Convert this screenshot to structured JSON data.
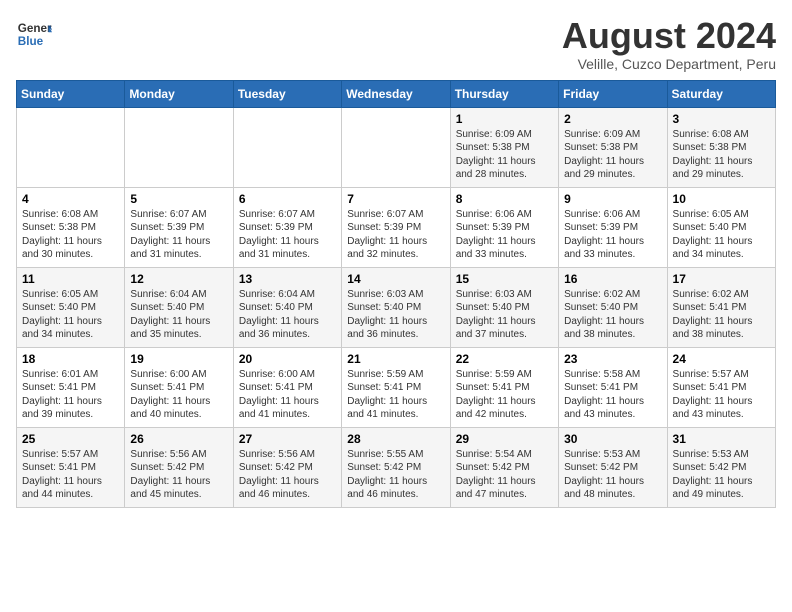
{
  "header": {
    "logo_general": "General",
    "logo_blue": "Blue",
    "month_year": "August 2024",
    "location": "Velille, Cuzco Department, Peru"
  },
  "weekdays": [
    "Sunday",
    "Monday",
    "Tuesday",
    "Wednesday",
    "Thursday",
    "Friday",
    "Saturday"
  ],
  "weeks": [
    [
      {
        "day": "",
        "info": ""
      },
      {
        "day": "",
        "info": ""
      },
      {
        "day": "",
        "info": ""
      },
      {
        "day": "",
        "info": ""
      },
      {
        "day": "1",
        "info": "Sunrise: 6:09 AM\nSunset: 5:38 PM\nDaylight: 11 hours\nand 28 minutes."
      },
      {
        "day": "2",
        "info": "Sunrise: 6:09 AM\nSunset: 5:38 PM\nDaylight: 11 hours\nand 29 minutes."
      },
      {
        "day": "3",
        "info": "Sunrise: 6:08 AM\nSunset: 5:38 PM\nDaylight: 11 hours\nand 29 minutes."
      }
    ],
    [
      {
        "day": "4",
        "info": "Sunrise: 6:08 AM\nSunset: 5:38 PM\nDaylight: 11 hours\nand 30 minutes."
      },
      {
        "day": "5",
        "info": "Sunrise: 6:07 AM\nSunset: 5:39 PM\nDaylight: 11 hours\nand 31 minutes."
      },
      {
        "day": "6",
        "info": "Sunrise: 6:07 AM\nSunset: 5:39 PM\nDaylight: 11 hours\nand 31 minutes."
      },
      {
        "day": "7",
        "info": "Sunrise: 6:07 AM\nSunset: 5:39 PM\nDaylight: 11 hours\nand 32 minutes."
      },
      {
        "day": "8",
        "info": "Sunrise: 6:06 AM\nSunset: 5:39 PM\nDaylight: 11 hours\nand 33 minutes."
      },
      {
        "day": "9",
        "info": "Sunrise: 6:06 AM\nSunset: 5:39 PM\nDaylight: 11 hours\nand 33 minutes."
      },
      {
        "day": "10",
        "info": "Sunrise: 6:05 AM\nSunset: 5:40 PM\nDaylight: 11 hours\nand 34 minutes."
      }
    ],
    [
      {
        "day": "11",
        "info": "Sunrise: 6:05 AM\nSunset: 5:40 PM\nDaylight: 11 hours\nand 34 minutes."
      },
      {
        "day": "12",
        "info": "Sunrise: 6:04 AM\nSunset: 5:40 PM\nDaylight: 11 hours\nand 35 minutes."
      },
      {
        "day": "13",
        "info": "Sunrise: 6:04 AM\nSunset: 5:40 PM\nDaylight: 11 hours\nand 36 minutes."
      },
      {
        "day": "14",
        "info": "Sunrise: 6:03 AM\nSunset: 5:40 PM\nDaylight: 11 hours\nand 36 minutes."
      },
      {
        "day": "15",
        "info": "Sunrise: 6:03 AM\nSunset: 5:40 PM\nDaylight: 11 hours\nand 37 minutes."
      },
      {
        "day": "16",
        "info": "Sunrise: 6:02 AM\nSunset: 5:40 PM\nDaylight: 11 hours\nand 38 minutes."
      },
      {
        "day": "17",
        "info": "Sunrise: 6:02 AM\nSunset: 5:41 PM\nDaylight: 11 hours\nand 38 minutes."
      }
    ],
    [
      {
        "day": "18",
        "info": "Sunrise: 6:01 AM\nSunset: 5:41 PM\nDaylight: 11 hours\nand 39 minutes."
      },
      {
        "day": "19",
        "info": "Sunrise: 6:00 AM\nSunset: 5:41 PM\nDaylight: 11 hours\nand 40 minutes."
      },
      {
        "day": "20",
        "info": "Sunrise: 6:00 AM\nSunset: 5:41 PM\nDaylight: 11 hours\nand 41 minutes."
      },
      {
        "day": "21",
        "info": "Sunrise: 5:59 AM\nSunset: 5:41 PM\nDaylight: 11 hours\nand 41 minutes."
      },
      {
        "day": "22",
        "info": "Sunrise: 5:59 AM\nSunset: 5:41 PM\nDaylight: 11 hours\nand 42 minutes."
      },
      {
        "day": "23",
        "info": "Sunrise: 5:58 AM\nSunset: 5:41 PM\nDaylight: 11 hours\nand 43 minutes."
      },
      {
        "day": "24",
        "info": "Sunrise: 5:57 AM\nSunset: 5:41 PM\nDaylight: 11 hours\nand 43 minutes."
      }
    ],
    [
      {
        "day": "25",
        "info": "Sunrise: 5:57 AM\nSunset: 5:41 PM\nDaylight: 11 hours\nand 44 minutes."
      },
      {
        "day": "26",
        "info": "Sunrise: 5:56 AM\nSunset: 5:42 PM\nDaylight: 11 hours\nand 45 minutes."
      },
      {
        "day": "27",
        "info": "Sunrise: 5:56 AM\nSunset: 5:42 PM\nDaylight: 11 hours\nand 46 minutes."
      },
      {
        "day": "28",
        "info": "Sunrise: 5:55 AM\nSunset: 5:42 PM\nDaylight: 11 hours\nand 46 minutes."
      },
      {
        "day": "29",
        "info": "Sunrise: 5:54 AM\nSunset: 5:42 PM\nDaylight: 11 hours\nand 47 minutes."
      },
      {
        "day": "30",
        "info": "Sunrise: 5:53 AM\nSunset: 5:42 PM\nDaylight: 11 hours\nand 48 minutes."
      },
      {
        "day": "31",
        "info": "Sunrise: 5:53 AM\nSunset: 5:42 PM\nDaylight: 11 hours\nand 49 minutes."
      }
    ]
  ]
}
